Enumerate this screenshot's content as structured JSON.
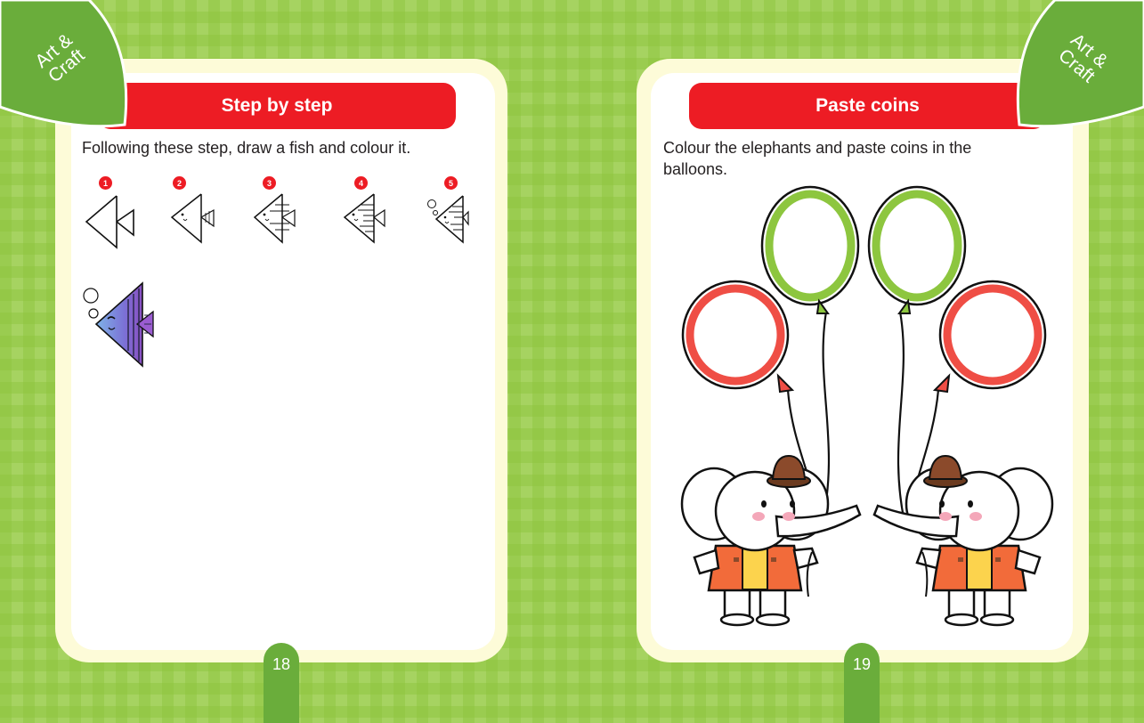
{
  "corner_tab": "Art &\nCraft",
  "left_page": {
    "title": "Step by step",
    "instruction": "Following these step, draw a fish and colour it.",
    "steps": [
      "1",
      "2",
      "3",
      "4",
      "5"
    ],
    "page_number": "18"
  },
  "right_page": {
    "title": "Paste coins",
    "instruction": "Colour the elephants and paste coins in the balloons.",
    "page_number": "19"
  },
  "colors": {
    "title_bar": "#ed1c24",
    "corner_green": "#6aad3b",
    "balloon_green": "#8dc63f",
    "balloon_red": "#ef4e45",
    "jacket": "#f26b3a",
    "hat": "#8b4a2b"
  }
}
